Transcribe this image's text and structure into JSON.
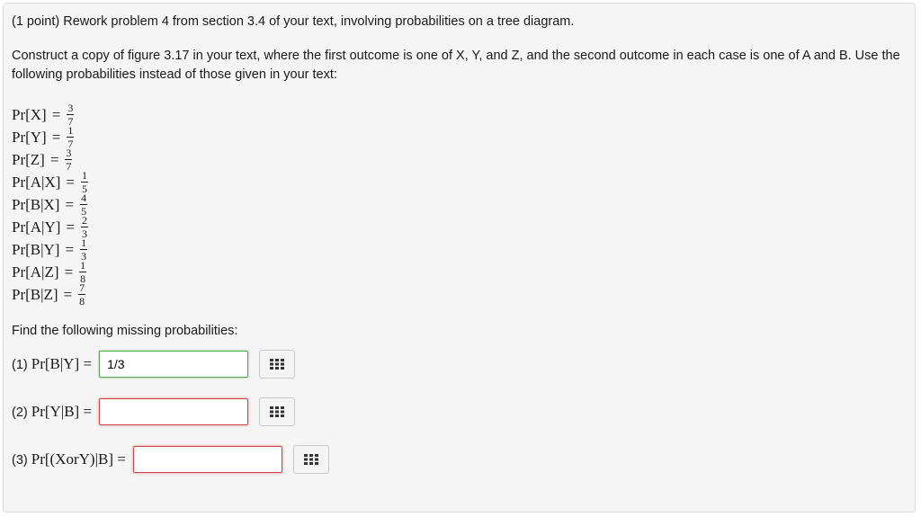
{
  "intro": "(1 point) Rework problem 4 from section 3.4 of your text, involving probabilities on a tree diagram.",
  "instructions": "Construct a copy of figure 3.17 in your text, where the first outcome is one of X, Y, and Z, and the second outcome in each case is one of A and B. Use the following probabilities instead of those given in your text:",
  "probabilities": [
    {
      "label": "Pr[X]",
      "num": "3",
      "den": "7"
    },
    {
      "label": "Pr[Y]",
      "num": "1",
      "den": "7"
    },
    {
      "label": "Pr[Z]",
      "num": "3",
      "den": "7"
    },
    {
      "label": "Pr[A|X]",
      "num": "1",
      "den": "5"
    },
    {
      "label": "Pr[B|X]",
      "num": "4",
      "den": "5"
    },
    {
      "label": "Pr[A|Y]",
      "num": "2",
      "den": "3"
    },
    {
      "label": "Pr[B|Y]",
      "num": "1",
      "den": "3"
    },
    {
      "label": "Pr[A|Z]",
      "num": "1",
      "den": "8"
    },
    {
      "label": "Pr[B|Z]",
      "num": "7",
      "den": "8"
    }
  ],
  "find_text": "Find the following missing probabilities:",
  "questions": [
    {
      "num": "(1)",
      "expr": "Pr[B|Y] =",
      "value": "1/3",
      "status": "correct"
    },
    {
      "num": "(2)",
      "expr": "Pr[Y|B] =",
      "value": "",
      "status": "incorrect"
    },
    {
      "num": "(3)",
      "expr": "Pr[(XorY)|B] =",
      "value": "",
      "status": "incorrect"
    }
  ],
  "equals": "=",
  "icons": {
    "equation_editor": "grid-icon"
  }
}
